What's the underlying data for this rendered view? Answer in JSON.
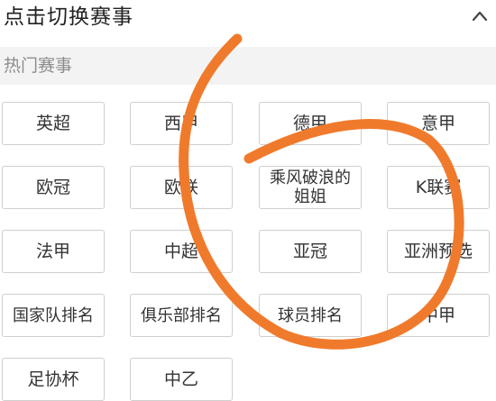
{
  "header": {
    "title": "点击切换赛事",
    "collapse_icon": "chevron-up-icon"
  },
  "section": {
    "title": "热门赛事"
  },
  "competitions": [
    "英超",
    "西甲",
    "德甲",
    "意甲",
    "欧冠",
    "欧联",
    "乘风破浪的姐姐",
    "K联赛",
    "法甲",
    "中超",
    "亚冠",
    "亚洲预选",
    "国家队排名",
    "俱乐部排名",
    "球员排名",
    "中甲",
    "足协杯",
    "中乙"
  ],
  "colors": {
    "annotation_stroke": "#f07a2c",
    "chip_border": "#cfcfcf",
    "section_bg": "#f3f3f3",
    "section_text": "#8c8c8c"
  }
}
